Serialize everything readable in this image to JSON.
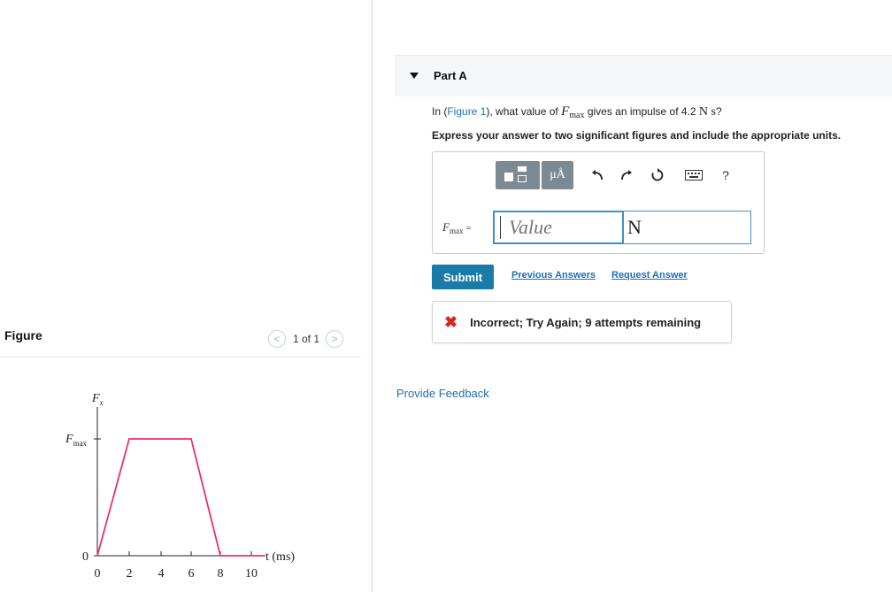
{
  "figure_panel": {
    "title": "Figure",
    "prev_label": "<",
    "next_label": ">",
    "page_counter": "1 of 1",
    "graph": {
      "y_label_main": "F",
      "y_label_sub": "x",
      "fmax_main": "F",
      "fmax_sub": "max",
      "x_label": "t (ms)",
      "y_zero": "0",
      "x_ticks": [
        "0",
        "2",
        "4",
        "6",
        "8",
        "10"
      ],
      "line_color": "#e8336a"
    }
  },
  "part": {
    "title": "Part A"
  },
  "question": {
    "prefix": "In (",
    "figure_link": "Figure 1",
    "middle": "), what value of ",
    "var_main": "F",
    "var_sub": "max",
    "after_var": " gives an impulse of 4.2 ",
    "unit": "N s",
    "suffix": "?"
  },
  "instruction": "Express your answer to two significant figures and include the appropriate units.",
  "toolbar": {
    "units_label": "μÅ",
    "help_label": "?",
    "icons": [
      "templates-icon",
      "units-icon",
      "undo-icon",
      "redo-icon",
      "reset-icon",
      "keyboard-icon",
      "help-icon"
    ]
  },
  "answer": {
    "label_main": "F",
    "label_sub": "max",
    "label_eq": "=",
    "value_placeholder": "Value",
    "unit_value": "N"
  },
  "actions": {
    "submit_label": "Submit",
    "previous_answers": "Previous Answers",
    "request_answer": "Request Answer"
  },
  "feedback": {
    "icon": "x-icon",
    "text": "Incorrect; Try Again; 9 attempts remaining",
    "color": "#d8261c"
  },
  "provide_feedback": "Provide Feedback",
  "colors": {
    "accent": "#1a7ba8",
    "link": "#1f6fb3",
    "input_border": "#3e8fd1"
  }
}
